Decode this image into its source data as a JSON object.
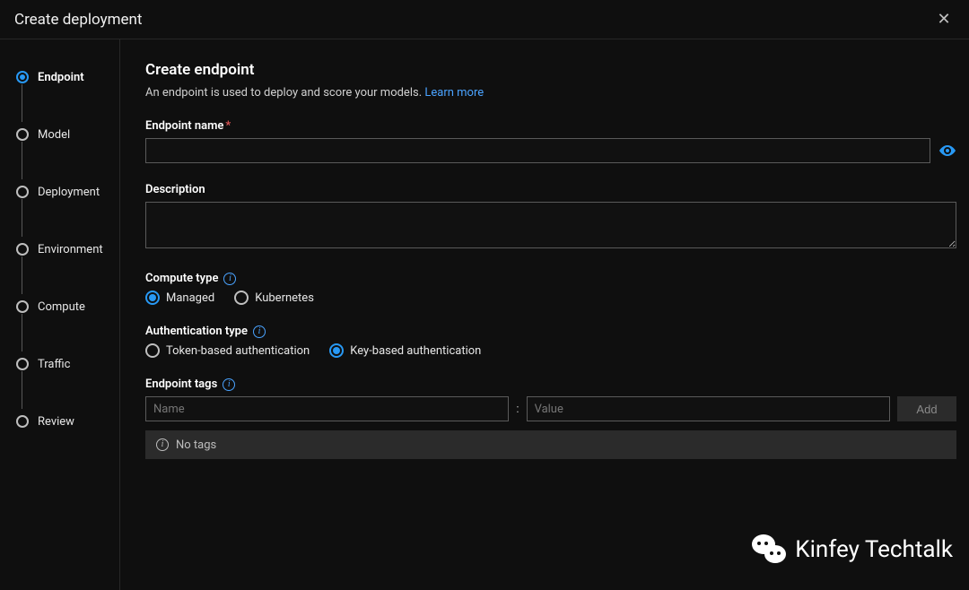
{
  "title": "Create deployment",
  "steps": [
    {
      "label": "Endpoint",
      "active": true
    },
    {
      "label": "Model",
      "active": false
    },
    {
      "label": "Deployment",
      "active": false
    },
    {
      "label": "Environment",
      "active": false
    },
    {
      "label": "Compute",
      "active": false
    },
    {
      "label": "Traffic",
      "active": false
    },
    {
      "label": "Review",
      "active": false
    }
  ],
  "main": {
    "heading": "Create endpoint",
    "description": "An endpoint is used to deploy and score your models.",
    "learn_more": "Learn more",
    "endpoint_name_label": "Endpoint name",
    "endpoint_name_value": "",
    "description_label": "Description",
    "description_value": "",
    "compute_type_label": "Compute type",
    "compute_options": {
      "managed": "Managed",
      "kubernetes": "Kubernetes"
    },
    "compute_selected": "managed",
    "auth_type_label": "Authentication type",
    "auth_options": {
      "token": "Token-based authentication",
      "key": "Key-based authentication"
    },
    "auth_selected": "key",
    "tags_label": "Endpoint tags",
    "tag_name_placeholder": "Name",
    "tag_value_placeholder": "Value",
    "tag_separator": ":",
    "add_btn": "Add",
    "no_tags": "No tags"
  },
  "watermark": "Kinfey Techtalk"
}
